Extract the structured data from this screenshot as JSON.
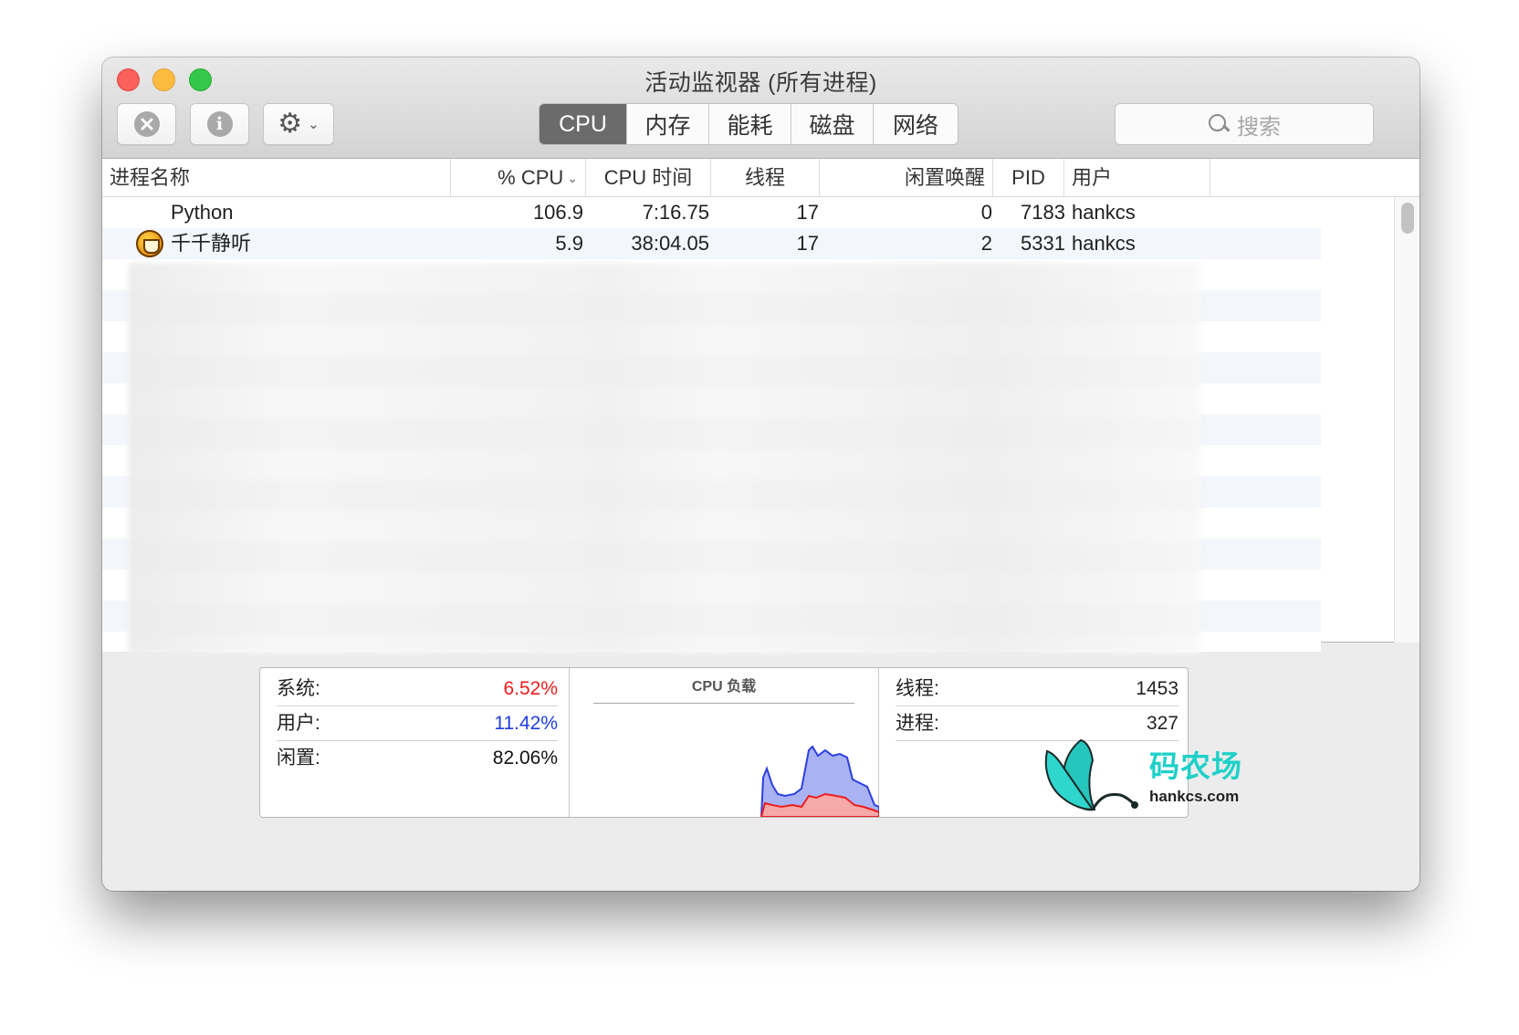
{
  "window": {
    "title": "活动监视器 (所有进程)"
  },
  "toolbar": {
    "stop_icon": "x-circle-icon",
    "info_icon": "info-icon",
    "info_glyph": "i",
    "gear_icon": "gear-icon",
    "tabs": [
      {
        "label": "CPU",
        "active": true
      },
      {
        "label": "内存",
        "active": false
      },
      {
        "label": "能耗",
        "active": false
      },
      {
        "label": "磁盘",
        "active": false
      },
      {
        "label": "网络",
        "active": false
      }
    ],
    "search_placeholder": "搜索"
  },
  "table": {
    "columns": [
      "进程名称",
      "% CPU",
      "CPU 时间",
      "线程",
      "闲置唤醒",
      "PID",
      "用户"
    ],
    "rows": [
      {
        "name": "Python",
        "cpu": "106.9",
        "cpu_time": "7:16.75",
        "threads": "17",
        "idle_wakeups": "0",
        "pid": "7183",
        "user": "hankcs",
        "icon": ""
      },
      {
        "name": "千千静听",
        "cpu": "5.9",
        "cpu_time": "38:04.05",
        "threads": "17",
        "idle_wakeups": "2",
        "pid": "5331",
        "user": "hankcs",
        "icon": "ttplayer-app-icon"
      }
    ]
  },
  "stats": {
    "system_label": "系统:",
    "system_value": "6.52%",
    "user_label": "用户:",
    "user_value": "11.42%",
    "idle_label": "闲置:",
    "idle_value": "82.06%",
    "load_title": "CPU 负载",
    "threads_label": "线程:",
    "threads_value": "1453",
    "processes_label": "进程:",
    "processes_value": "327"
  },
  "watermark": {
    "name": "码农场",
    "url": "hankcs.com"
  },
  "colors": {
    "system": "#f01c1c",
    "user": "#1f3ee0",
    "tab_active_bg": "#6b6b6b"
  }
}
